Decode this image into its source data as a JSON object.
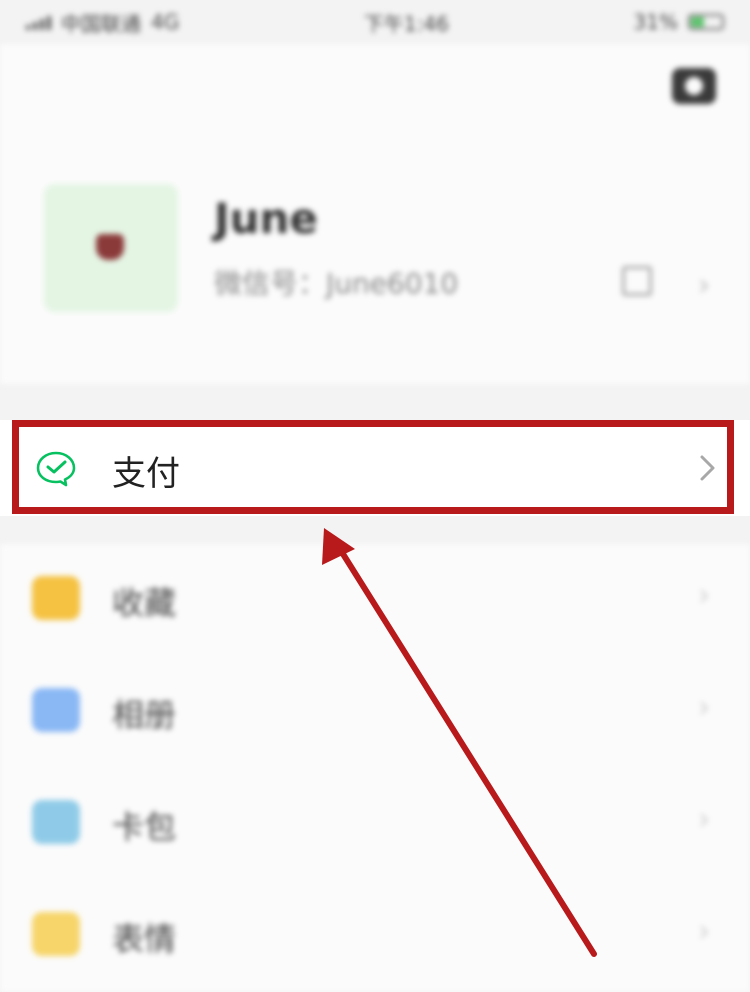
{
  "status_bar": {
    "carrier": "中国联通",
    "network": "4G",
    "time": "下午1:46",
    "battery": "31%"
  },
  "profile": {
    "name": "June",
    "wechat_id": "微信号：June6010"
  },
  "pay_item": {
    "label": "支付",
    "icon": "wechat-pay-icon"
  },
  "list_items": [
    {
      "label": "收藏",
      "icon": "favorites-icon",
      "color": "#f5c242"
    },
    {
      "label": "相册",
      "icon": "album-icon",
      "color": "#8ab8f5"
    },
    {
      "label": "卡包",
      "icon": "card-wallet-icon",
      "color": "#8fcbe8"
    },
    {
      "label": "表情",
      "icon": "sticker-icon",
      "color": "#f7d56a"
    }
  ],
  "colors": {
    "highlight": "#b8191b",
    "wechat_green": "#07c160"
  }
}
